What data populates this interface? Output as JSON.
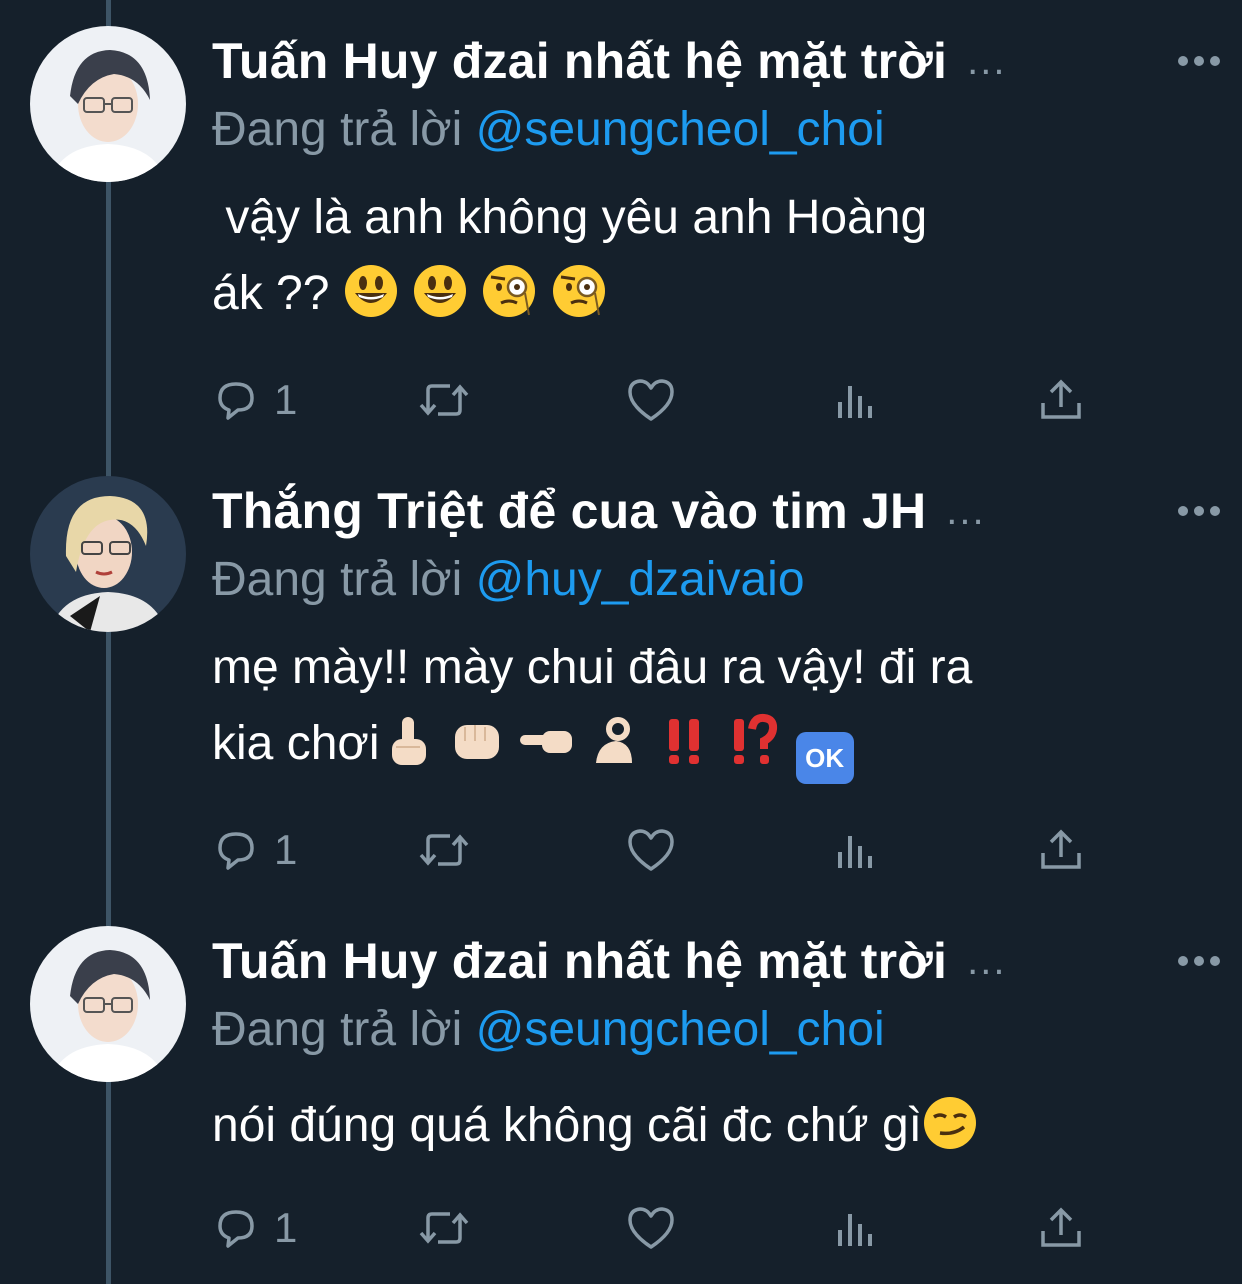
{
  "tweets": [
    {
      "display_name": "Tuấn Huy đzai nhất hệ mặt trời",
      "name_ellipsis": "...",
      "reply_prefix": "Đang trả lời",
      "reply_handle": "@seungcheol_choi",
      "text_line1": " vậy là anh không yêu anh Hoàng",
      "text_line2": "ák ??",
      "emojis": [
        "smiling-face-icon",
        "smiling-face-icon",
        "face-with-monocle-icon",
        "face-with-monocle-icon"
      ],
      "reply_count": "1"
    },
    {
      "display_name": "Thắng Triệt để cua vào tim JH",
      "name_ellipsis": "...",
      "reply_prefix": "Đang trả lời",
      "reply_handle": "@huy_dzaivaio",
      "text_line1": "mẹ mày!! mày chui đâu ra vậy! đi ra",
      "text_line2": "kia chơi",
      "emojis": [
        "index-pointing-up-icon",
        "oncoming-fist-icon",
        "backhand-index-pointing-left-icon",
        "ok-hand-icon",
        "double-exclamation-icon",
        "exclamation-question-icon",
        "ok-button-icon"
      ],
      "ok_label": "OK",
      "reply_count": "1"
    },
    {
      "display_name": "Tuấn Huy đzai nhất hệ mặt trời",
      "name_ellipsis": "...",
      "reply_prefix": "Đang trả lời",
      "reply_handle": "@seungcheol_choi",
      "text_line1": "nói đúng quá không cãi đc chứ gì",
      "emojis": [
        "smirking-face-icon"
      ],
      "reply_count": "1"
    }
  ],
  "colors": {
    "background": "#15202b",
    "muted": "#8899a6",
    "link": "#1d9bf0",
    "thread_line": "#3d5466"
  }
}
